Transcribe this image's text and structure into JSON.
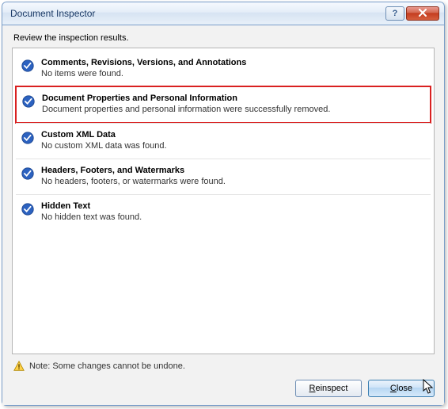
{
  "titlebar": {
    "title": "Document Inspector"
  },
  "instruction": "Review the inspection results.",
  "results": [
    {
      "title": "Comments, Revisions, Versions, and Annotations",
      "desc": "No items were found."
    },
    {
      "title": "Document Properties and Personal Information",
      "desc": "Document properties and personal information were successfully removed."
    },
    {
      "title": "Custom XML Data",
      "desc": "No custom XML data was found."
    },
    {
      "title": "Headers, Footers, and Watermarks",
      "desc": "No headers, footers, or watermarks were found."
    },
    {
      "title": "Hidden Text",
      "desc": "No hidden text was found."
    }
  ],
  "note": "Note: Some changes cannot be undone.",
  "buttons": {
    "reinspect": "Reinspect",
    "close": "Close"
  }
}
